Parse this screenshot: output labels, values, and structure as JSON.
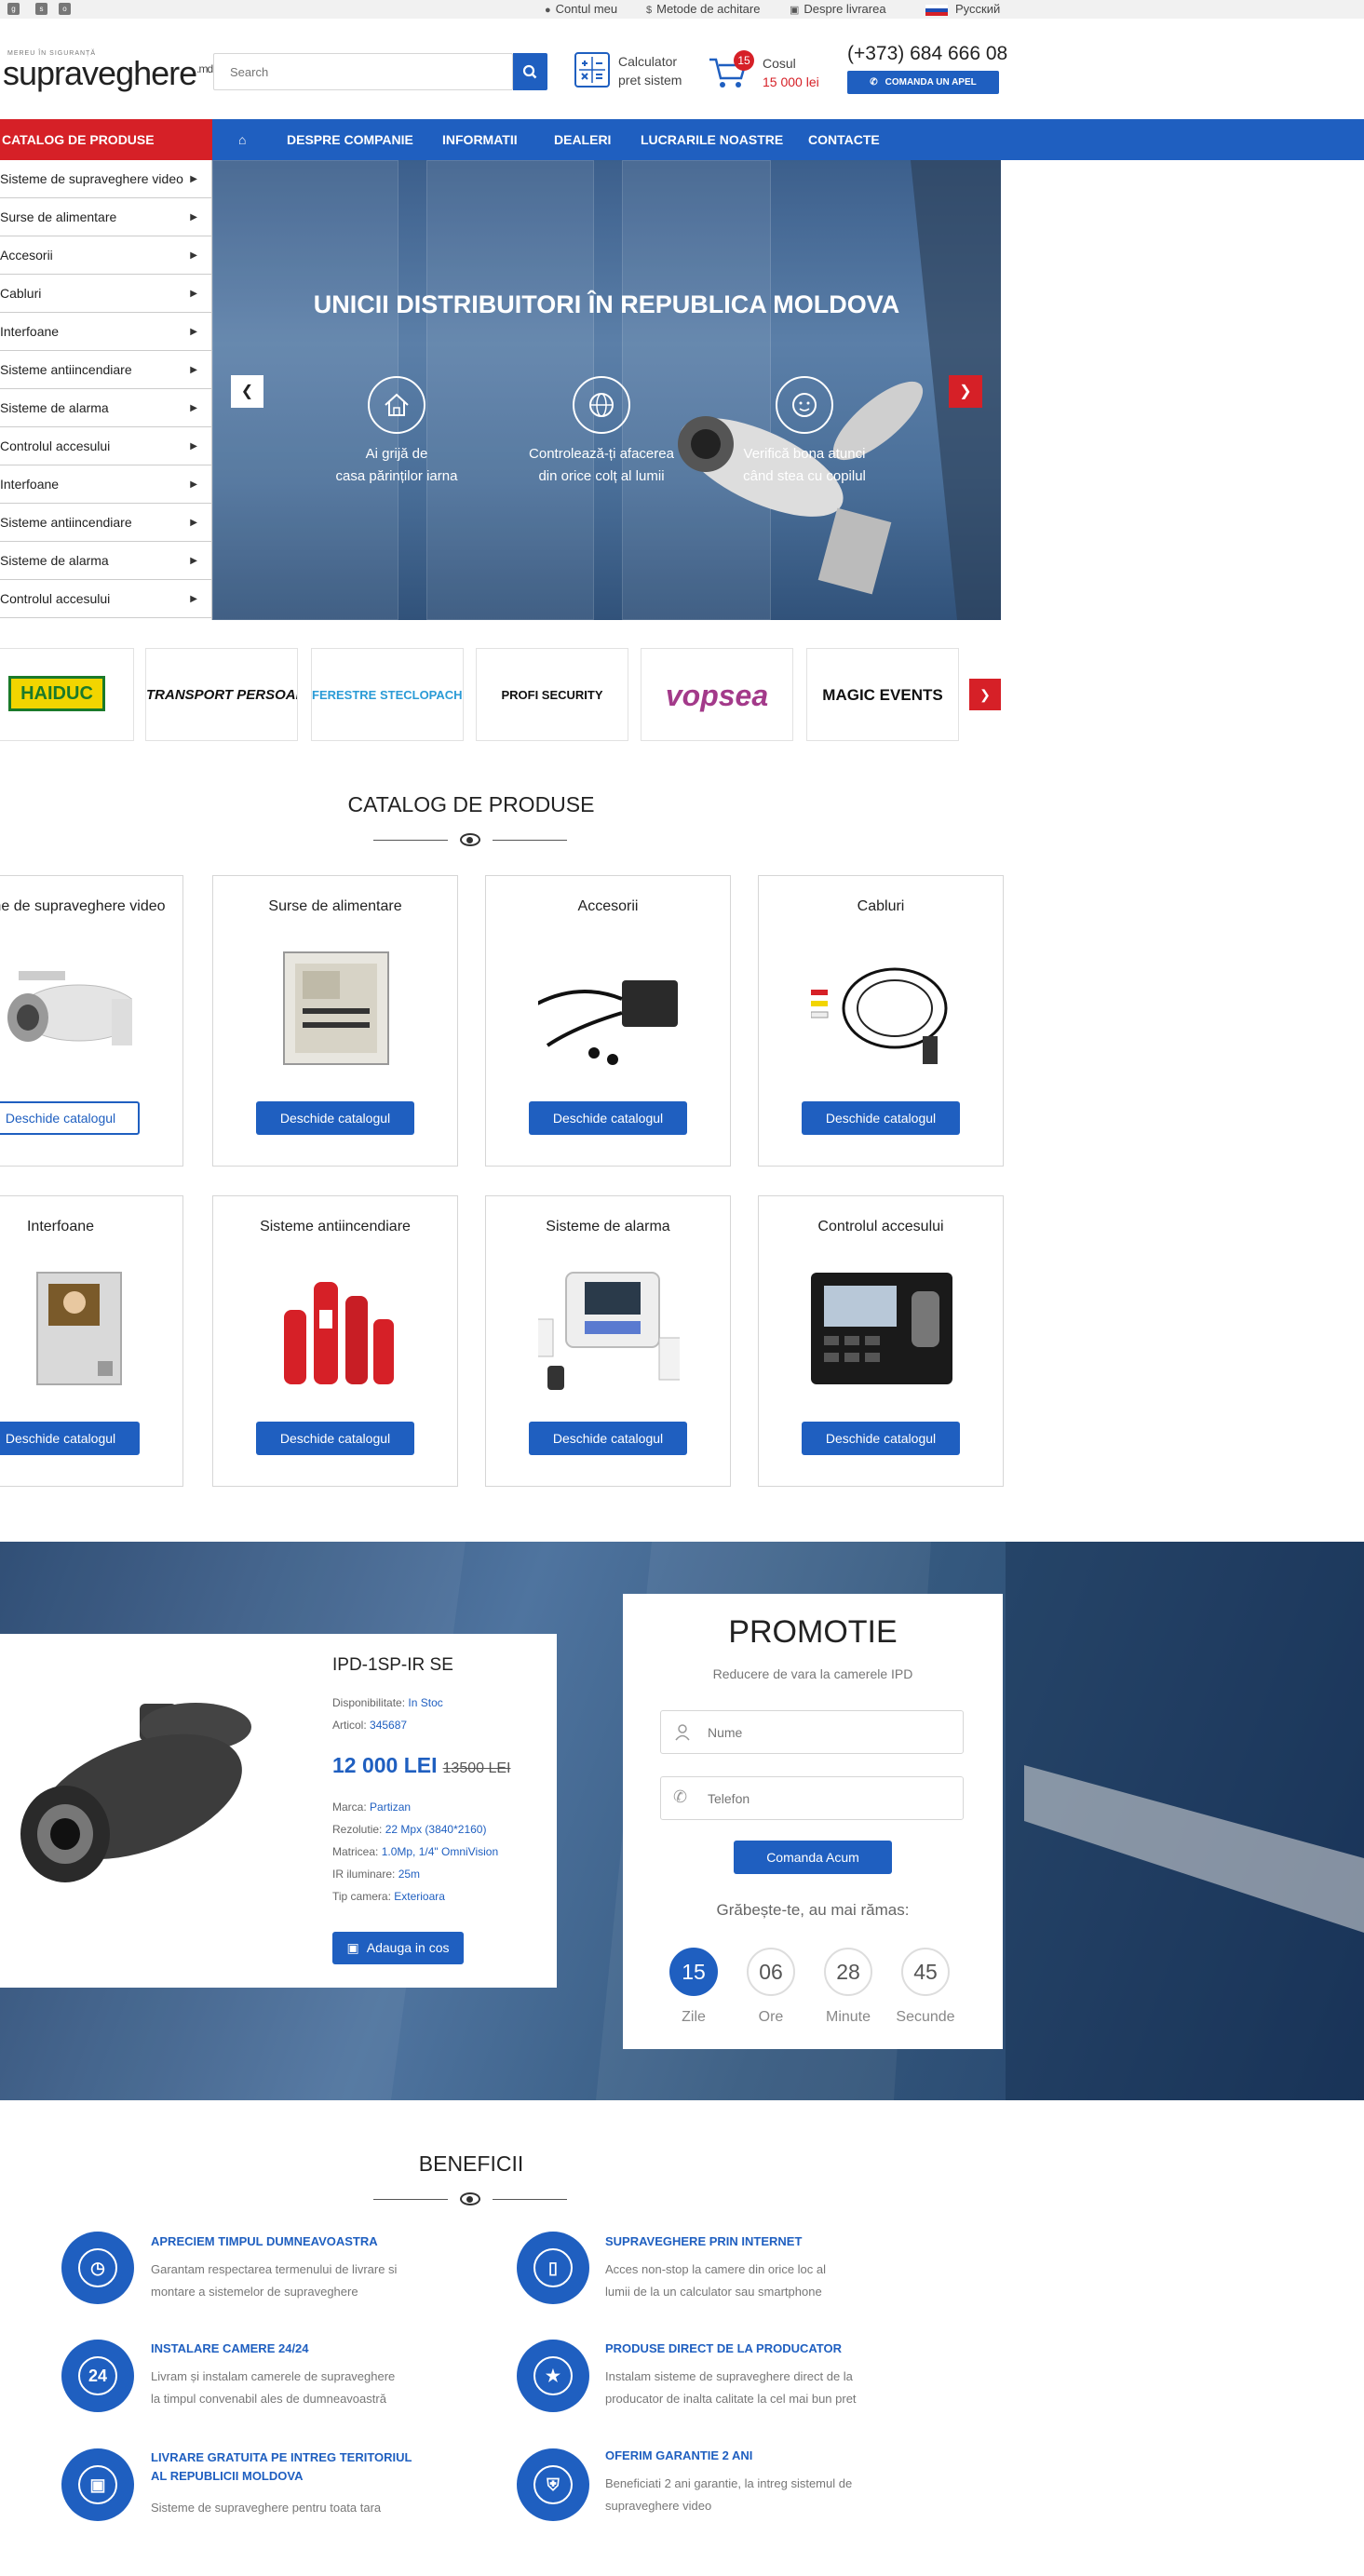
{
  "topbar": {
    "social": [
      "google-plus-icon",
      "skype-icon",
      "odnoklassniki-icon"
    ],
    "links": [
      {
        "icon": "user-icon",
        "label": "Contul meu"
      },
      {
        "icon": "dollar-icon",
        "label": "Metode de achitare"
      },
      {
        "icon": "truck-icon",
        "label": "Despre livrarea"
      },
      {
        "icon": "russia-flag-icon",
        "label": "Русский"
      }
    ]
  },
  "header": {
    "logo_tagline": "MEREU ÎN SIGURANȚĂ",
    "logo": "supraveghere",
    "logo_suffix": ".md",
    "search_placeholder": "Search",
    "calc_line1": "Calculator",
    "calc_line2": "pret sistem",
    "cart_count": "15",
    "cart_label": "Cosul",
    "cart_total": "15 000 lei",
    "phone": "(+373) 684 666 08",
    "call_button": "COMANDA UN APEL"
  },
  "nav": {
    "catalog_label": "CATALOG DE PRODUSE",
    "items": [
      "DESPRE COMPANIE",
      "INFORMATII",
      "DEALERI",
      "LUCRARILE NOASTRE",
      "CONTACTE"
    ]
  },
  "sidebar": {
    "items": [
      "Sisteme de supraveghere video",
      "Surse de alimentare",
      "Accesorii",
      "Cabluri",
      "Interfoane",
      "Sisteme antiincendiare",
      "Sisteme de alarma",
      "Controlul accesului",
      "Interfoane",
      "Sisteme antiincendiare",
      "Sisteme de alarma",
      "Controlul accesului"
    ]
  },
  "slider": {
    "title": "UNICII DISTRIBUITORI ÎN REPUBLICA MOLDOVA",
    "features": [
      {
        "icon": "house-icon",
        "line1": "Ai grijă de",
        "line2": "casa părinților iarna"
      },
      {
        "icon": "globe-icon",
        "line1": "Controlează-ți afacerea",
        "line2": "din orice colț al lumii"
      },
      {
        "icon": "child-face-icon",
        "line1": "Verifică bona atunci",
        "line2": "când stea cu copilul"
      }
    ],
    "slides_count": 3,
    "active_slide": 1
  },
  "partners": [
    "HAIDUC",
    "TRANSPORT PERSOANE.MD",
    "FERESTRE STECLOPACHET.MD",
    "PROFI SECURITY",
    "vopsea",
    "MAGIC EVENTS"
  ],
  "catalog": {
    "title": "CATALOG DE PRODUSE",
    "button_label": "Deschide catalogul",
    "products": [
      {
        "title": "Sisteme de supraveghere video",
        "image": "camera-image"
      },
      {
        "title": "Surse de alimentare",
        "image": "power-box-image"
      },
      {
        "title": "Accesorii",
        "image": "poe-injector-image"
      },
      {
        "title": "Cabluri",
        "image": "cable-image"
      },
      {
        "title": "Interfoane",
        "image": "intercom-image"
      },
      {
        "title": "Sisteme antiincendiare",
        "image": "extinguisher-image"
      },
      {
        "title": "Sisteme de alarma",
        "image": "alarm-panel-image"
      },
      {
        "title": "Controlul accesului",
        "image": "access-terminal-image"
      }
    ]
  },
  "promo_product": {
    "name": "IPD-1SP-IR SE",
    "availability_label": "Disponibilitate:",
    "availability": "In Stoc",
    "article_label": "Articol:",
    "article": "345687",
    "price": "12 000 LEI",
    "old_price": "13500 LEI",
    "specs": [
      {
        "label": "Marca:",
        "value": "Partizan"
      },
      {
        "label": "Rezolutie:",
        "value": "22 Mpx (3840*2160)"
      },
      {
        "label": "Matricea:",
        "value": "1.0Mp, 1/4\" OmniVision"
      },
      {
        "label": "IR iluminare:",
        "value": "25m"
      },
      {
        "label": "Tip camera:",
        "value": "Exterioara"
      }
    ],
    "add_to_cart": "Adauga in cos"
  },
  "promotion": {
    "title": "PROMOTIE",
    "subtitle": "Reducere de vara la camerele IPD",
    "name_placeholder": "Nume",
    "phone_placeholder": "Telefon",
    "button": "Comanda Acum",
    "hurry": "Grăbește-te, au mai rămas:",
    "countdown": [
      {
        "value": "15",
        "label": "Zile"
      },
      {
        "value": "06",
        "label": "Ore"
      },
      {
        "value": "28",
        "label": "Minute"
      },
      {
        "value": "45",
        "label": "Secunde"
      }
    ]
  },
  "benefits": {
    "title": "BENEFICII",
    "items": [
      {
        "icon": "clock-icon",
        "title": "APRECIEM TIMPUL DUMNEAVOASTRA",
        "title2": "",
        "line1": "Garantam respectarea termenului de livrare si",
        "line2": "montare a sistemelor de supraveghere"
      },
      {
        "icon": "smartphone-icon",
        "title": "SUPRAVEGHERE PRIN INTERNET",
        "title2": "",
        "line1": "Acces non-stop la camere din orice loc al",
        "line2": "lumii de la un calculator sau smartphone"
      },
      {
        "icon": "clock-24-icon",
        "title": "INSTALARE CAMERE 24/24",
        "title2": "",
        "line1": "Livram și instalam camerele de supraveghere",
        "line2": "la timpul convenabil ales de dumneavoastră"
      },
      {
        "icon": "award-icon",
        "title": "PRODUSE DIRECT DE LA PRODUCATOR",
        "title2": "",
        "line1": "Instalam sisteme de supraveghere direct de la",
        "line2": "producator de inalta calitate la cel mai bun pret"
      },
      {
        "icon": "delivery-truck-icon",
        "title": "LIVRARE GRATUITA PE INTREG TERITORIUL",
        "title2": "AL REPUBLICII MOLDOVA",
        "line1": "Sisteme de supraveghere pentru toata tara",
        "line2": ""
      },
      {
        "icon": "shield-icon",
        "title": "OFERIM GARANTIE 2 ANI",
        "title2": "",
        "line1": "Beneficiati 2 ani garantie, la intreg sistemul de",
        "line2": "supraveghere video"
      }
    ]
  },
  "colors": {
    "primary": "#1f5fc0",
    "accent": "#d62027"
  }
}
